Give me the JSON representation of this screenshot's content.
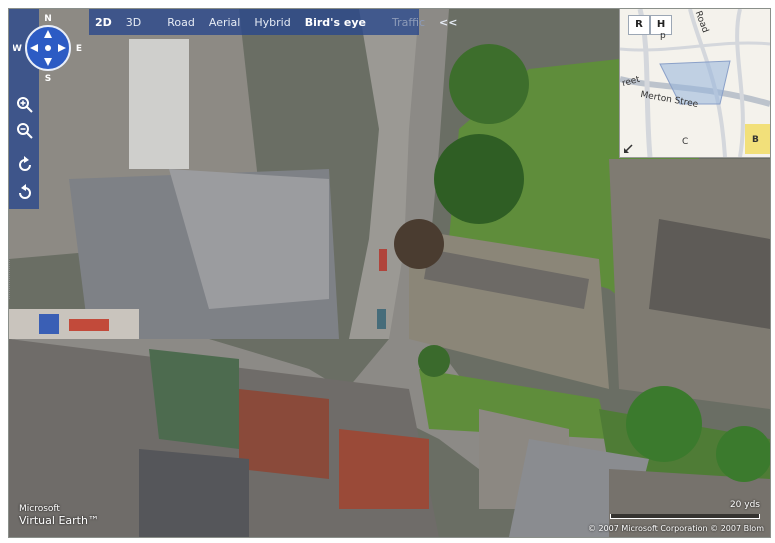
{
  "toolbar": {
    "mode_2d": "2D",
    "mode_3d": "3D",
    "road": "Road",
    "aerial": "Aerial",
    "hybrid": "Hybrid",
    "birds_eye": "Bird's eye",
    "traffic": "Traffic",
    "collapse": "<<"
  },
  "compass": {
    "n": "N",
    "s": "S",
    "e": "E",
    "w": "W"
  },
  "overview": {
    "btn_road": "R",
    "btn_hybrid": "H",
    "labels": {
      "merton": "Merton Stree",
      "road": "Road",
      "street_fragment": "reet",
      "ov_p": "p",
      "ov_b": "B",
      "ov_c": "C"
    }
  },
  "logo": {
    "line1": "Microsoft",
    "line2": "Virtual Earth™"
  },
  "scale": {
    "label": "20 yds"
  },
  "copyright": "© 2007 Microsoft Corporation  © 2007 Blom",
  "colors": {
    "panel": "#2c4a8f",
    "grass": "#5a8a3a",
    "roof": "#7a7d82",
    "road": "#8a8986"
  }
}
